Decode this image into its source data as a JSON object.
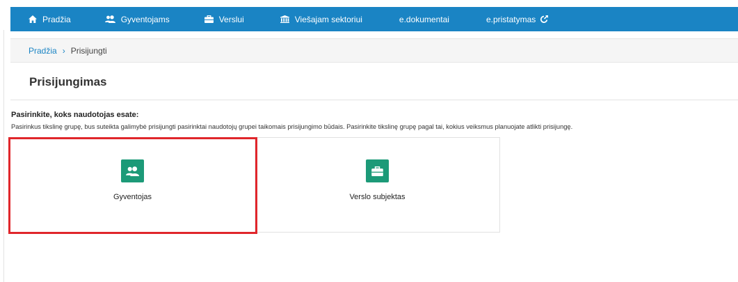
{
  "nav": {
    "items": [
      {
        "label": "Pradžia",
        "icon": "home-icon"
      },
      {
        "label": "Gyventojams",
        "icon": "users-icon"
      },
      {
        "label": "Verslui",
        "icon": "briefcase-icon"
      },
      {
        "label": "Viešajam sektoriui",
        "icon": "institution-icon"
      },
      {
        "label": "e.dokumentai"
      },
      {
        "label": "e.pristatymas",
        "icon": "external-link-icon"
      }
    ]
  },
  "breadcrumb": {
    "home": "Pradžia",
    "separator": "›",
    "current": "Prisijungti"
  },
  "page": {
    "title": "Prisijungimas",
    "heading": "Pasirinkite, koks naudotojas esate:",
    "description": "Pasirinkus tikslinę grupę, bus suteikta galimybė prisijungti pasirinktai naudotojų grupei taikomais prisijungimo būdais. Pasirinkite tikslinę grupę pagal tai, kokius veiksmus planuojate atlikti prisijungę."
  },
  "cards": [
    {
      "label": "Gyventojas",
      "icon": "users-icon"
    },
    {
      "label": "Verslo subjektas",
      "icon": "briefcase-icon"
    }
  ],
  "colors": {
    "nav_bg": "#1a84c4",
    "card_icon_bg": "#1c9a78",
    "highlight": "#e0262b"
  }
}
